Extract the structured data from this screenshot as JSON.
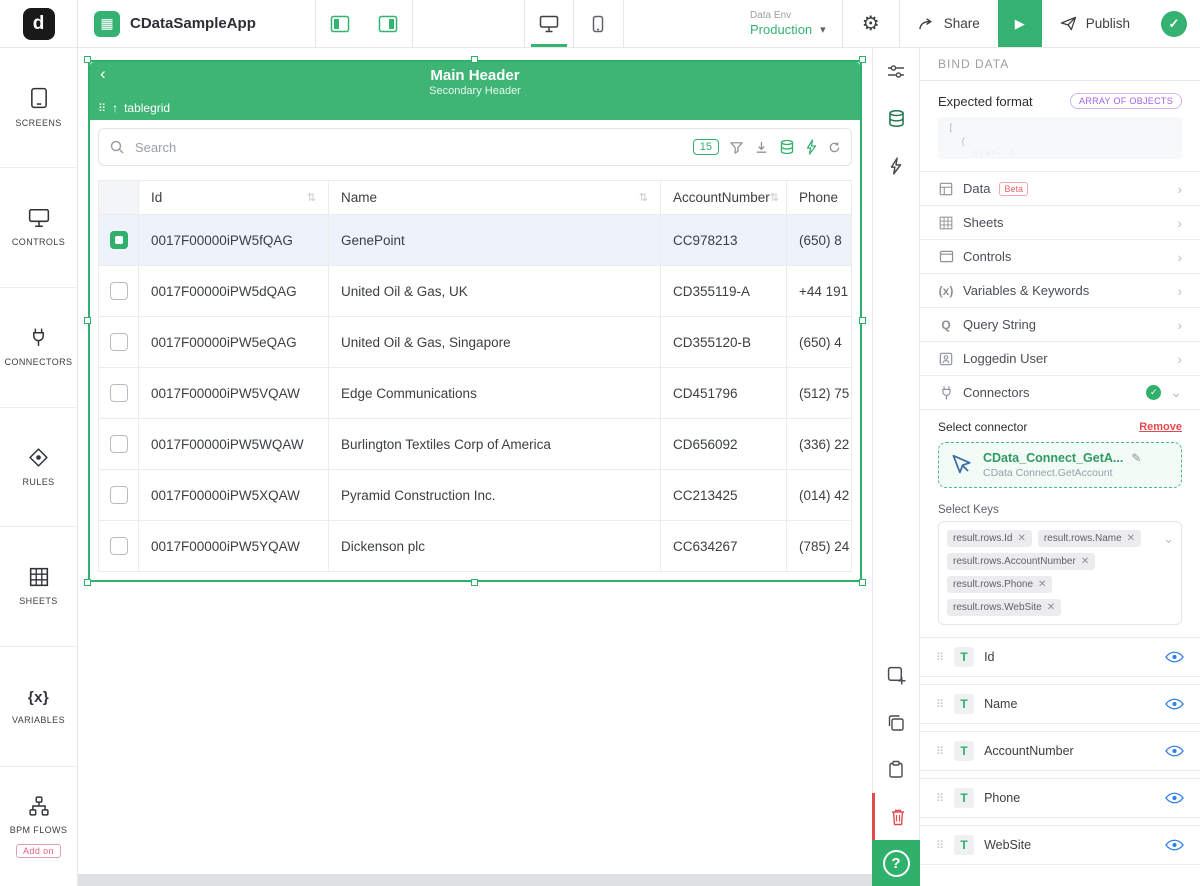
{
  "colors": {
    "accent_green": "#2fb06b",
    "badge_purple": "#a55eea",
    "danger_red": "#e5484d",
    "eye_blue": "#2f80ed"
  },
  "topbar": {
    "logo_letter": "d",
    "app_name": "CDataSampleApp",
    "env_label": "Data Env",
    "env_value": "Production",
    "share_label": "Share",
    "publish_label": "Publish"
  },
  "sidebar": {
    "items": [
      {
        "label": "SCREENS"
      },
      {
        "label": "CONTROLS"
      },
      {
        "label": "CONNECTORS"
      },
      {
        "label": "RULES"
      },
      {
        "label": "SHEETS"
      },
      {
        "label": "VARIABLES"
      },
      {
        "label": "BPM FLOWS",
        "badge": "Add on"
      }
    ]
  },
  "canvas": {
    "main_header": "Main Header",
    "secondary_header": "Secondary Header",
    "control_label": "tablegrid",
    "table": {
      "search_placeholder": "Search",
      "page_size": "15",
      "columns": [
        "Id",
        "Name",
        "AccountNumber",
        "Phone"
      ],
      "rows": [
        {
          "id": "0017F00000iPW5fQAG",
          "name": "GenePoint",
          "account_number": "CC978213",
          "phone": "(650) 8"
        },
        {
          "id": "0017F00000iPW5dQAG",
          "name": "United Oil & Gas, UK",
          "account_number": "CD355119-A",
          "phone": "+44 191"
        },
        {
          "id": "0017F00000iPW5eQAG",
          "name": "United Oil & Gas, Singapore",
          "account_number": "CD355120-B",
          "phone": "(650) 4"
        },
        {
          "id": "0017F00000iPW5VQAW",
          "name": "Edge Communications",
          "account_number": "CD451796",
          "phone": "(512) 75"
        },
        {
          "id": "0017F00000iPW5WQAW",
          "name": "Burlington Textiles Corp of America",
          "account_number": "CD656092",
          "phone": "(336) 22"
        },
        {
          "id": "0017F00000iPW5XQAW",
          "name": "Pyramid Construction Inc.",
          "account_number": "CC213425",
          "phone": "(014) 42"
        },
        {
          "id": "0017F00000iPW5YQAW",
          "name": "Dickenson plc",
          "account_number": "CC634267",
          "phone": "(785) 24"
        }
      ]
    }
  },
  "bind_panel": {
    "title": "BIND DATA",
    "expected_format_label": "Expected format",
    "expected_format_badge": "ARRAY OF OBJECTS",
    "code_preview": "[\n  {\n    \"id\": [",
    "sections": [
      {
        "label": "Data",
        "badge": "Beta"
      },
      {
        "label": "Sheets"
      },
      {
        "label": "Controls"
      },
      {
        "label": "Variables & Keywords"
      },
      {
        "label": "Query String"
      },
      {
        "label": "Loggedin User"
      },
      {
        "label": "Connectors"
      }
    ],
    "select_connector_label": "Select connector",
    "remove_label": "Remove",
    "connector_name": "CData_Connect_GetA...",
    "connector_subtitle": "CData Connect.GetAccount",
    "select_keys_label": "Select Keys",
    "keys": [
      "result.rows.Id",
      "result.rows.Name",
      "result.rows.AccountNumber",
      "result.rows.Phone",
      "result.rows.WebSite"
    ],
    "fields": [
      "Id",
      "Name",
      "AccountNumber",
      "Phone",
      "WebSite"
    ]
  }
}
